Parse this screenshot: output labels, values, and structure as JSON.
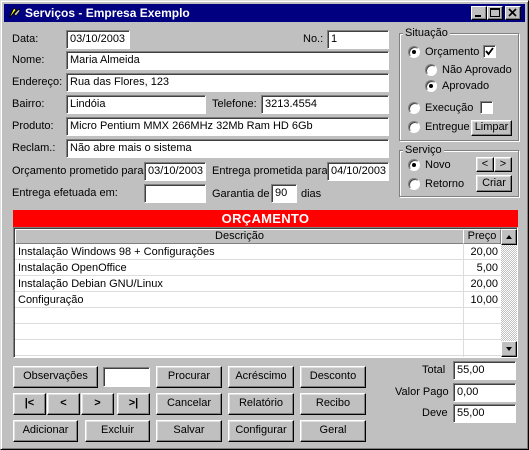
{
  "window": {
    "title": "Serviços - Empresa Exemplo"
  },
  "form": {
    "data_label": "Data:",
    "data_value": "03/10/2003",
    "no_label": "No.:",
    "no_value": "1",
    "nome_label": "Nome:",
    "nome_value": "Maria Almeida",
    "endereco_label": "Endereço:",
    "endereco_value": "Rua das Flores, 123",
    "bairro_label": "Bairro:",
    "bairro_value": "Lindóia",
    "telefone_label": "Telefone:",
    "telefone_value": "3213.4554",
    "produto_label": "Produto:",
    "produto_value": "Micro Pentium MMX 266MHz 32Mb Ram HD 6Gb",
    "reclam_label": "Reclam.:",
    "reclam_value": "Não abre mais o sistema",
    "orc_prometido_label": "Orçamento prometido para:",
    "orc_prometido_value": "03/10/2003",
    "entrega_prometida_label": "Entrega prometida para:",
    "entrega_prometida_value": "04/10/2003",
    "entrega_efetuada_label": "Entrega efetuada em:",
    "entrega_efetuada_value": "",
    "garantia_label": "Garantia de",
    "garantia_value": "90",
    "dias_label": "dias"
  },
  "situacao": {
    "title": "Situação",
    "orcamento_label": "Orçamento",
    "orcamento_checked": true,
    "nao_aprovado_label": "Não Aprovado",
    "aprovado_label": "Aprovado",
    "execucao_label": "Execução",
    "execucao_checked": false,
    "entregue_label": "Entregue",
    "limpar_label": "Limpar"
  },
  "servico": {
    "title": "Serviço",
    "novo_label": "Novo",
    "retorno_label": "Retorno",
    "prev_label": "<",
    "next_label": ">",
    "criar_label": "Criar"
  },
  "orcamento": {
    "banner": "ORÇAMENTO",
    "columns": [
      "Descrição",
      "Preço"
    ],
    "rows": [
      {
        "descricao": "Instalação Windows  98 + Configurações",
        "preco": "20,00"
      },
      {
        "descricao": "Instalação OpenOffice",
        "preco": "5,00"
      },
      {
        "descricao": "Instalação Debian GNU/Linux",
        "preco": "20,00"
      },
      {
        "descricao": "Configuração",
        "preco": "10,00"
      },
      {
        "descricao": "",
        "preco": ""
      },
      {
        "descricao": "",
        "preco": ""
      },
      {
        "descricao": "",
        "preco": ""
      }
    ]
  },
  "buttons": {
    "observacoes": "Observações",
    "procurar": "Procurar",
    "acrescimo": "Acréscimo",
    "desconto": "Desconto",
    "first": "|<",
    "prev": "<",
    "next": ">",
    "last": ">|",
    "cancelar": "Cancelar",
    "relatorio": "Relatório",
    "recibo": "Recibo",
    "adicionar": "Adicionar",
    "excluir": "Excluir",
    "salvar": "Salvar",
    "configurar": "Configurar",
    "geral": "Geral",
    "search_value": ""
  },
  "totals": {
    "total_label": "Total",
    "total_value": "55,00",
    "valor_pago_label": "Valor Pago",
    "valor_pago_value": "0,00",
    "deve_label": "Deve",
    "deve_value": "55,00"
  }
}
